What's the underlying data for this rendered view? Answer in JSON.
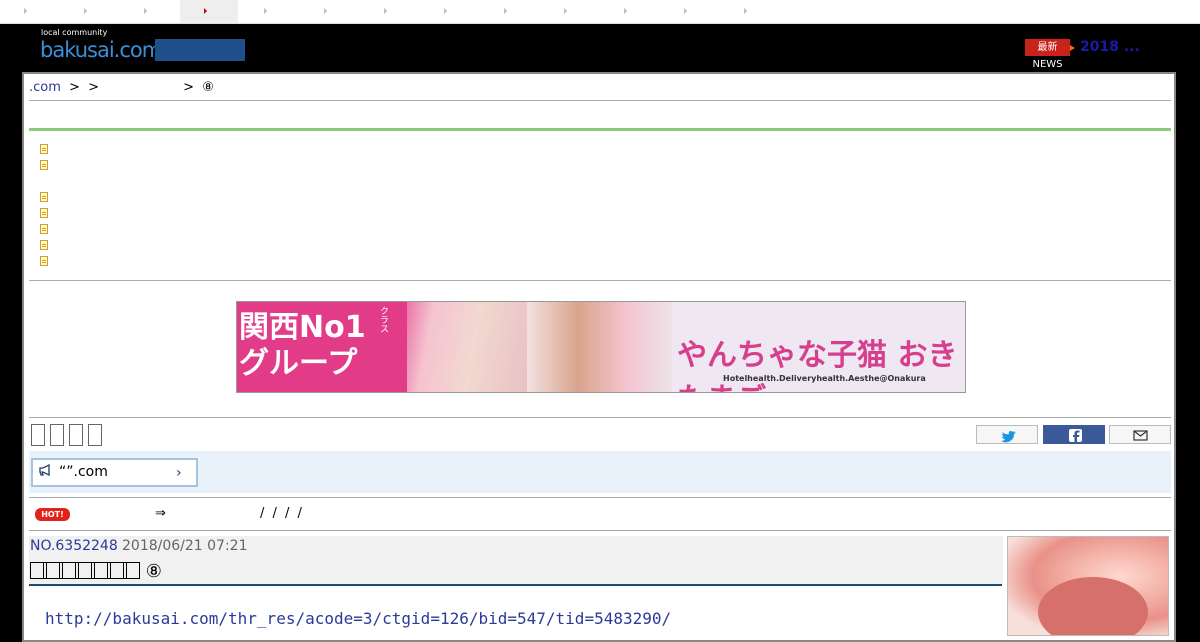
{
  "tabs": {
    "count": 13,
    "active_index": 3
  },
  "header": {
    "logo_small": "local community",
    "logo_main": "bakusai.com",
    "news_badge": "最新NEWS",
    "news_text": "2018 ..."
  },
  "breadcrumb": {
    "items": [
      ".com",
      ">",
      ">",
      ">",
      "⑧"
    ]
  },
  "sidebar_links": {
    "count": 7
  },
  "banner": {
    "left_text": "関西No1\nグループ",
    "left_tag": "クラス",
    "right_text": "やんちゃな子猫 おきたまご",
    "right_sub": "Hotelhealth.Deliveryhealth.Aesthe@Onakura"
  },
  "filter_squares": {
    "count": 5
  },
  "share": {
    "twitter_icon": "twitter-icon",
    "facebook_icon": "facebook-icon",
    "mail_icon": "mail-icon"
  },
  "notice": {
    "text": "“”.com",
    "chevron": "›"
  },
  "hot": {
    "badge": "HOT!",
    "arrow": "⇒",
    "slashes": "/ / / /"
  },
  "post": {
    "number": "NO.6352248",
    "date": "2018/06/21 07:21",
    "title": "⑧",
    "url": "http://bakusai.com/thr_res/acode=3/ctgid=126/bid=547/tid=5483290/"
  },
  "colors": {
    "accent_blue": "#2a3a9a",
    "green_rule": "#8cc97d",
    "hot_red": "#e0241b",
    "facebook": "#3b5998"
  }
}
